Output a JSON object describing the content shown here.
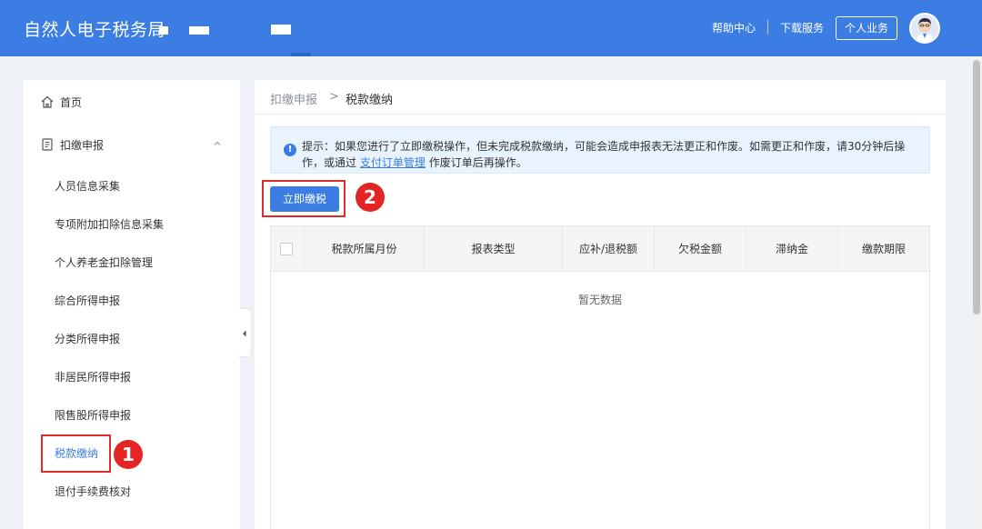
{
  "header": {
    "app_title": "自然人电子税务局",
    "help_center": "帮助中心",
    "download_service": "下载服务",
    "personal_business": "个人业务"
  },
  "sidebar": {
    "home": "首页",
    "group": "扣缴申报",
    "items": [
      "人员信息采集",
      "专项附加扣除信息采集",
      "个人养老金扣除管理",
      "综合所得申报",
      "分类所得申报",
      "非居民所得申报",
      "限售股所得申报",
      "税款缴纳",
      "退付手续费核对"
    ],
    "active_index": 7
  },
  "breadcrumb": {
    "parent": "扣缴申报",
    "separator": ">",
    "current": "税款缴纳"
  },
  "notice": {
    "icon": "info-icon",
    "line1": "提示：如果您进行了立即缴税操作，但未完成税款缴纳，可能会造成申报表无法更正和作废。如需更正和作废，请30分钟后操",
    "line2_prefix": "作，或通过",
    "line2_link": "支付订单管理",
    "line2_suffix": "作废订单后再操作。"
  },
  "actions": {
    "pay_now": "立即缴税"
  },
  "table": {
    "columns": [
      "税款所属月份",
      "报表类型",
      "应补/退税额",
      "欠税金额",
      "滞纳金",
      "缴款期限"
    ],
    "rows": [],
    "empty_text": "暂无数据"
  },
  "annotations": {
    "step1": "1",
    "step2": "2"
  },
  "colors": {
    "brand": "#3b7de3",
    "highlight": "#e02b2b"
  }
}
